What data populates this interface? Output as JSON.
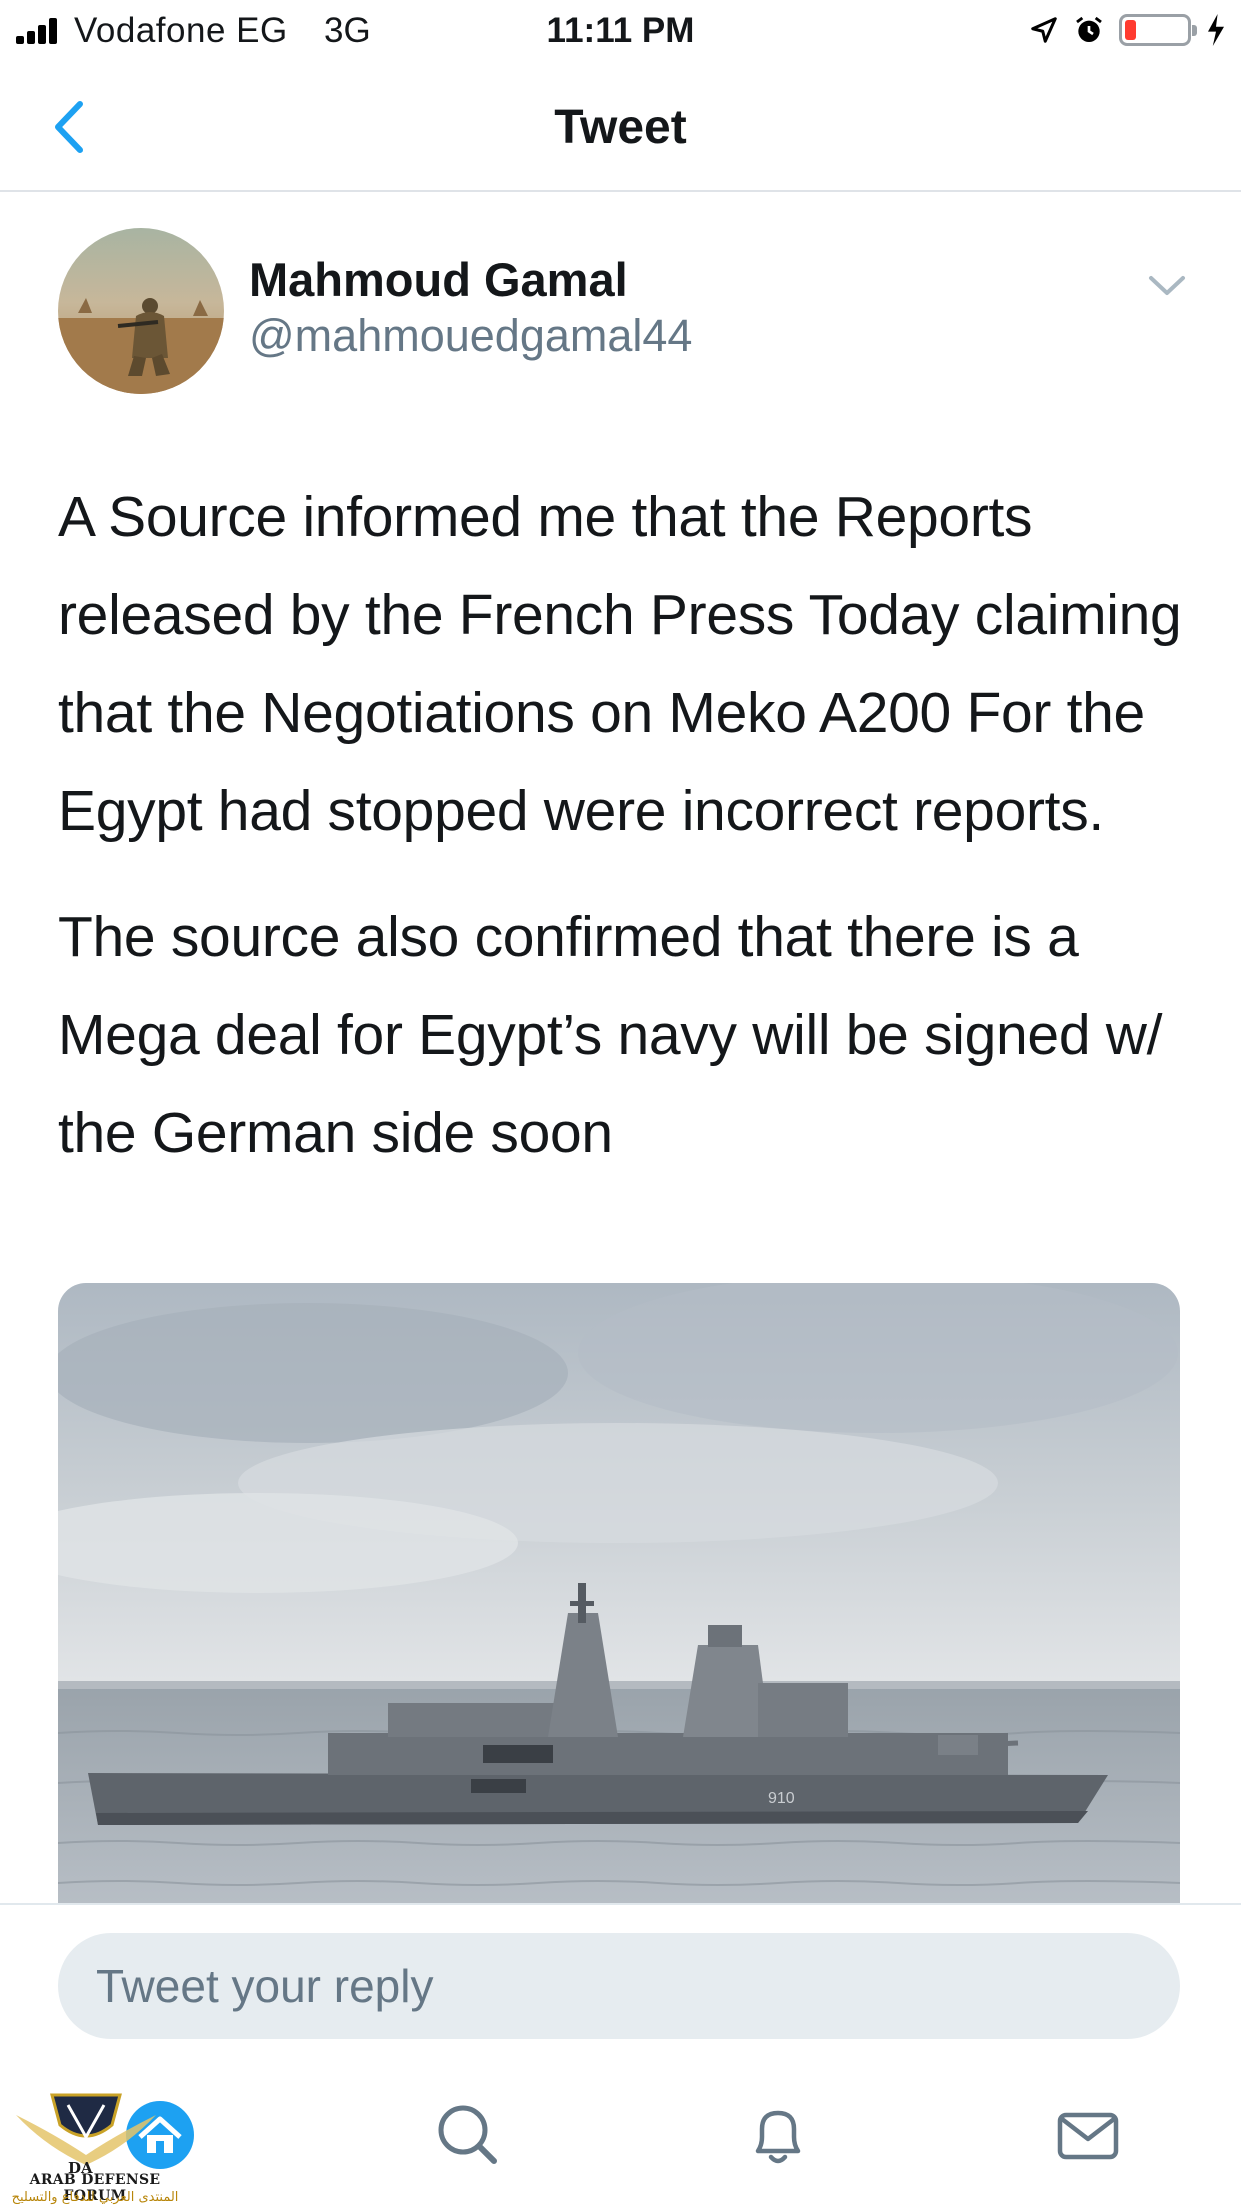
{
  "status_bar": {
    "carrier": "Vodafone EG",
    "network": "3G",
    "time": "11:11 PM",
    "icons": [
      "signal-icon",
      "location-icon",
      "alarm-icon",
      "battery-icon",
      "charging-icon"
    ],
    "battery_level": 0.12,
    "battery_color": "#ff3b30"
  },
  "nav": {
    "title": "Tweet",
    "back_icon": "chevron-left-icon",
    "accent_color": "#1da1f2"
  },
  "tweet": {
    "author": {
      "display_name": "Mahmoud Gamal",
      "handle": "@mahmouedgamal44"
    },
    "paragraphs": [
      "A Source informed me that the Reports released by the French Press Today claiming that the Negotiations on Meko A200 For the Egypt had stopped were incorrect reports.",
      "The source also confirmed that there is a Mega deal for Egypt’s navy will be signed w/ the German side soon"
    ],
    "media": {
      "hull_number": "910"
    }
  },
  "reply": {
    "placeholder": "Tweet your reply"
  },
  "tab_bar": {
    "tabs": [
      "home-icon",
      "search-icon",
      "notifications-icon",
      "messages-icon"
    ]
  },
  "watermark": {
    "logo_text": "DA",
    "title": "ARAB DEFENSE FORUM",
    "subtitle": "المنتدى العربي للدفاع والتسليح"
  }
}
